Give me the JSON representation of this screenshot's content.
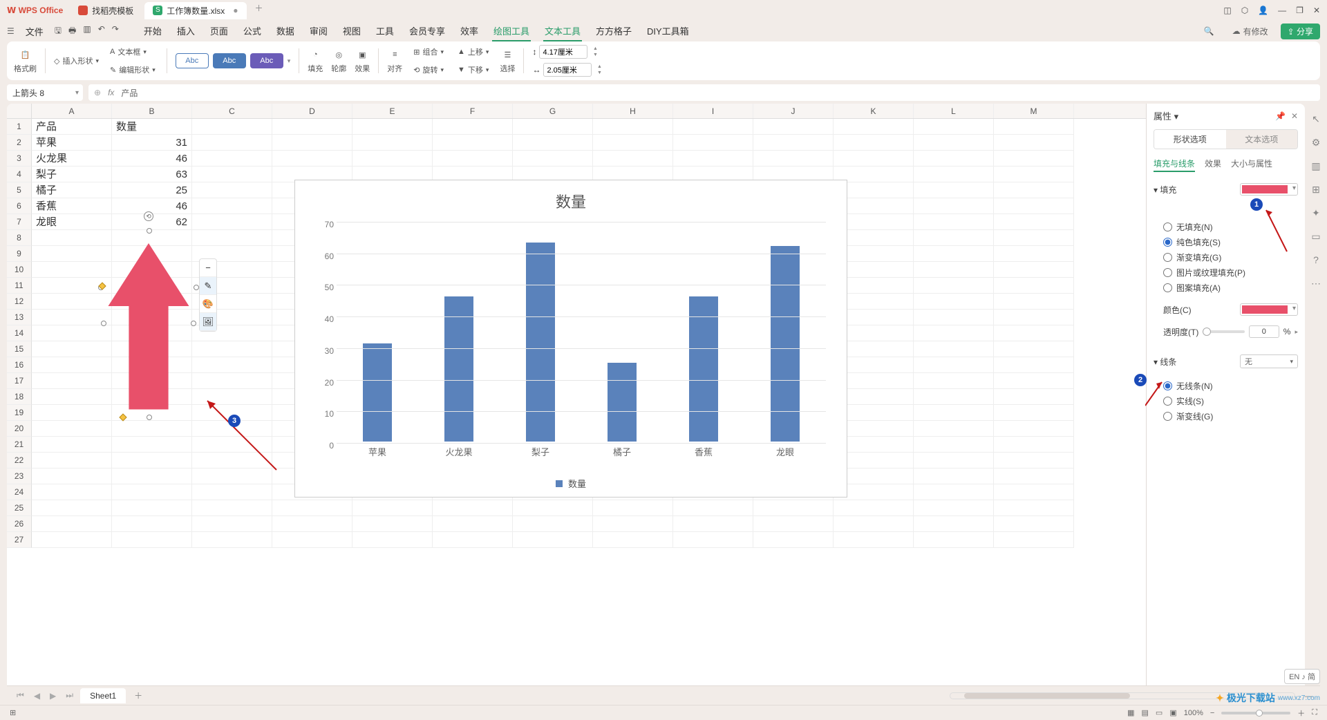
{
  "titlebar": {
    "app_name": "WPS Office",
    "tabs": [
      {
        "label": "找稻壳模板",
        "icon_color": "#d84a3a"
      },
      {
        "label": "工作簿数量.xlsx",
        "icon_color": "#2fa86d",
        "active": true
      }
    ]
  },
  "menubar": {
    "file_label": "文件",
    "menus": [
      "开始",
      "插入",
      "页面",
      "公式",
      "数据",
      "审阅",
      "视图",
      "工具",
      "会员专享",
      "效率",
      "绘图工具",
      "文本工具",
      "方方格子",
      "DIY工具箱"
    ],
    "active_indexes": [
      10,
      11
    ],
    "cloud_label": "有修改",
    "share_label": "分享"
  },
  "ribbon": {
    "format_painter": "格式刷",
    "insert_shape": "插入形状",
    "text_box": "文本框",
    "edit_shape": "编辑形状",
    "style_label": "Abc",
    "fill": "填充",
    "outline": "轮廓",
    "effects": "效果",
    "align": "对齐",
    "group": "组合",
    "rotate": "旋转",
    "move_up": "上移",
    "move_down": "下移",
    "selection": "选择",
    "height_val": "4.17厘米",
    "width_val": "2.05厘米"
  },
  "name_box": "上箭头 8",
  "formula_val": "产品",
  "columns": [
    "A",
    "B",
    "C",
    "D",
    "E",
    "F",
    "G",
    "H",
    "I",
    "J",
    "K",
    "L",
    "M"
  ],
  "row_count": 27,
  "cells": {
    "A1": "产品",
    "B1": "数量",
    "A2": "苹果",
    "B2": "31",
    "A3": "火龙果",
    "B3": "46",
    "A4": "梨子",
    "B4": "63",
    "A5": "橘子",
    "B5": "25",
    "A6": "香蕉",
    "B6": "46",
    "A7": "龙眼",
    "B7": "62"
  },
  "chart_data": {
    "type": "bar",
    "title": "数量",
    "categories": [
      "苹果",
      "火龙果",
      "梨子",
      "橘子",
      "香蕉",
      "龙眼"
    ],
    "values": [
      31,
      46,
      63,
      25,
      46,
      62
    ],
    "ylim": [
      0,
      70
    ],
    "yticks": [
      0,
      10,
      20,
      30,
      40,
      50,
      60,
      70
    ],
    "legend": "数量"
  },
  "properties_panel": {
    "title": "属性",
    "tab_shape": "形状选项",
    "tab_text": "文本选项",
    "subtab_fill": "填充与线条",
    "subtab_effect": "效果",
    "subtab_size": "大小与属性",
    "fill_section": "填充",
    "fill_options": [
      "无填充(N)",
      "纯色填充(S)",
      "渐变填充(G)",
      "图片或纹理填充(P)",
      "图案填充(A)"
    ],
    "fill_selected": 1,
    "color_label": "颜色(C)",
    "fill_color": "#e8506a",
    "transparency_label": "透明度(T)",
    "transparency_value": "0",
    "transparency_unit": "%",
    "line_section": "线条",
    "line_style": "无",
    "line_options": [
      "无线条(N)",
      "实线(S)",
      "渐变线(G)"
    ],
    "line_selected": 0
  },
  "sheet_tabs": {
    "active": "Sheet1"
  },
  "status_bar": {
    "lang": "EN ♪ 简",
    "zoom": "100%"
  },
  "watermark": {
    "name": "极光下载站",
    "url": "www.xz7.com"
  },
  "annotations": {
    "n1": "1",
    "n2": "2",
    "n3": "3"
  }
}
